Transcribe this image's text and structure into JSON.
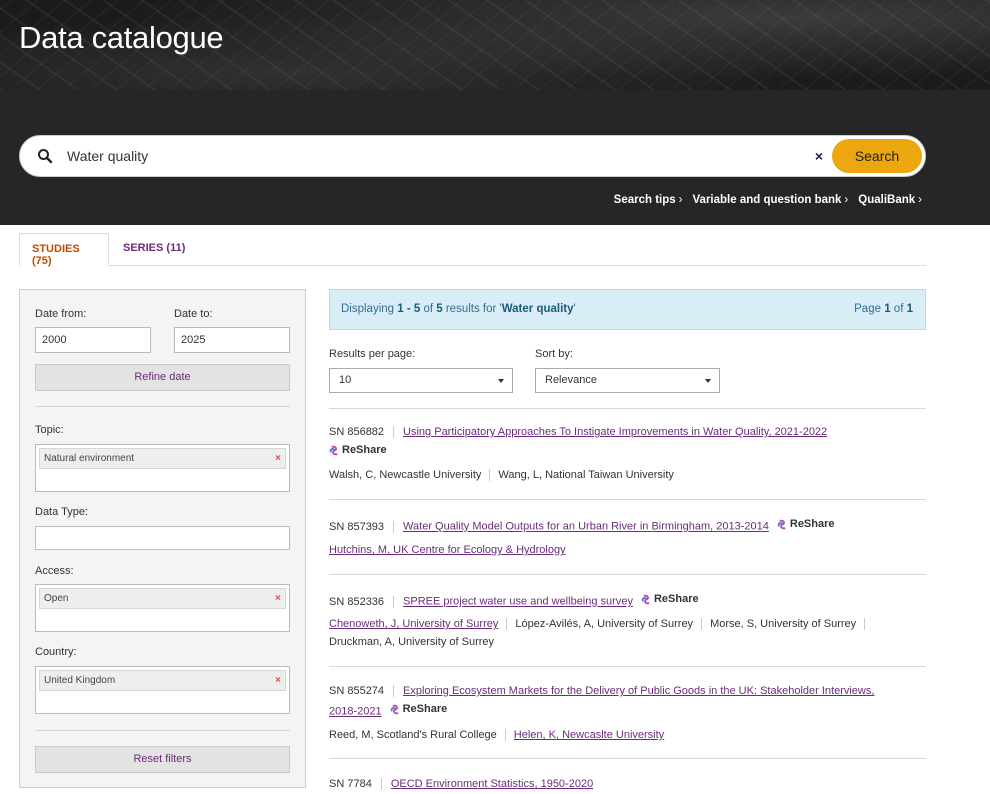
{
  "header": {
    "title": "Data catalogue"
  },
  "search": {
    "value": "Water quality",
    "clear_label": "×",
    "button_label": "Search",
    "links": [
      {
        "label": "Search tips",
        "chev": "›"
      },
      {
        "label": "Variable and question bank",
        "chev": "›"
      },
      {
        "label": "QualiBank",
        "chev": "›"
      }
    ]
  },
  "tabs": [
    {
      "label": "STUDIES (75)",
      "active": true
    },
    {
      "label": "SERIES (11)",
      "active": false
    }
  ],
  "filters": {
    "date_from_label": "Date from:",
    "date_from_value": "2000",
    "date_to_label": "Date to:",
    "date_to_value": "2025",
    "refine_label": "Refine date",
    "topic_label": "Topic:",
    "topic_chip": "Natural environment",
    "data_type_label": "Data Type:",
    "access_label": "Access:",
    "access_chip": "Open",
    "country_label": "Country:",
    "country_chip": "United Kingdom",
    "chip_remove": "×",
    "reset_label": "Reset filters"
  },
  "results_info": {
    "prefix": "Displaying ",
    "range": "1 - 5",
    "of": " of ",
    "total": "5",
    "mid": " results for '",
    "query": "Water quality",
    "suffix": "'",
    "page_prefix": "Page ",
    "page": "1",
    "page_of": " of ",
    "pages": "1"
  },
  "controls": {
    "per_page_label": "Results per page:",
    "per_page_value": "10",
    "sort_label": "Sort by:",
    "sort_value": "Relevance"
  },
  "reshare_label": "ReShare",
  "results": [
    {
      "sn": "SN 856882",
      "title": "Using Participatory Approaches To Instigate Improvements in Water Quality, 2021-2022",
      "creators": [
        {
          "name": "Walsh, C, Newcastle University",
          "link": false
        },
        {
          "name": "Wang, L, National Taiwan University",
          "link": false
        }
      ]
    },
    {
      "sn": "SN 857393",
      "title": "Water Quality Model Outputs for an Urban River in Birmingham, 2013-2014",
      "creators": [
        {
          "name": "Hutchins, M, UK Centre for Ecology & Hydrology",
          "link": true
        }
      ]
    },
    {
      "sn": "SN 852336",
      "title": "SPREE project water use and wellbeing survey",
      "creators": [
        {
          "name": "Chenoweth, J, University of Surrey",
          "link": true
        },
        {
          "name": "López-Avilés, A, University of Surrey",
          "link": false
        },
        {
          "name": "Morse, S, University of Surrey",
          "link": false
        },
        {
          "name": "Druckman, A, University of Surrey",
          "link": false
        }
      ]
    },
    {
      "sn": "SN 855274",
      "title_line1": "Exploring Ecosystem Markets for the Delivery of Public Goods in the UK: Stakeholder Interviews,",
      "title_line2": "2018-2021",
      "creators": [
        {
          "name": "Reed, M, Scotland's Rural College",
          "link": false
        },
        {
          "name": "Helen, K, Newcaslte University",
          "link": true
        }
      ]
    },
    {
      "sn": "SN 7784",
      "title": "OECD Environment Statistics, 1950-2020",
      "creators": []
    }
  ]
}
